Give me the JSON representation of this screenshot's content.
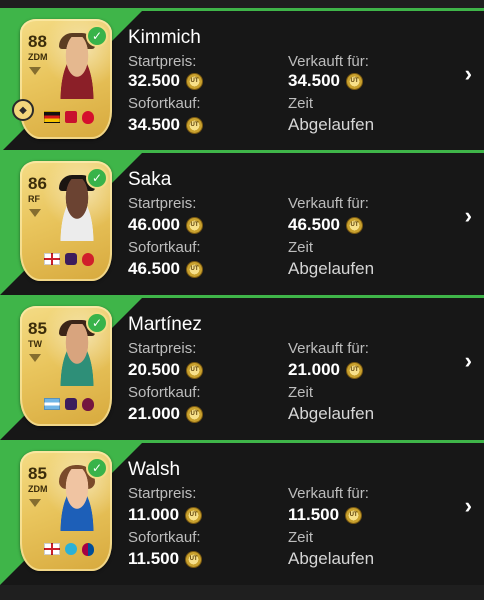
{
  "labels": {
    "start": "Startpreis:",
    "buy_now": "Sofortkauf:",
    "sold_for": "Verkauft für:",
    "time": "Zeit",
    "status": "Abgelaufen"
  },
  "coin_label": "UT",
  "items": [
    {
      "name": "Kimmich",
      "rating": "88",
      "position": "ZDM",
      "start": "32.500",
      "buy_now": "34.500",
      "sold_for": "34.500"
    },
    {
      "name": "Saka",
      "rating": "86",
      "position": "RF",
      "start": "46.000",
      "buy_now": "46.500",
      "sold_for": "46.500"
    },
    {
      "name": "Martínez",
      "rating": "85",
      "position": "TW",
      "start": "20.500",
      "buy_now": "21.000",
      "sold_for": "21.000"
    },
    {
      "name": "Walsh",
      "rating": "85",
      "position": "ZDM",
      "start": "11.000",
      "buy_now": "11.500",
      "sold_for": "11.500"
    }
  ],
  "colors": {
    "accent": "#3fb549",
    "background": "#171717",
    "card_gold": "#e9c55d"
  }
}
